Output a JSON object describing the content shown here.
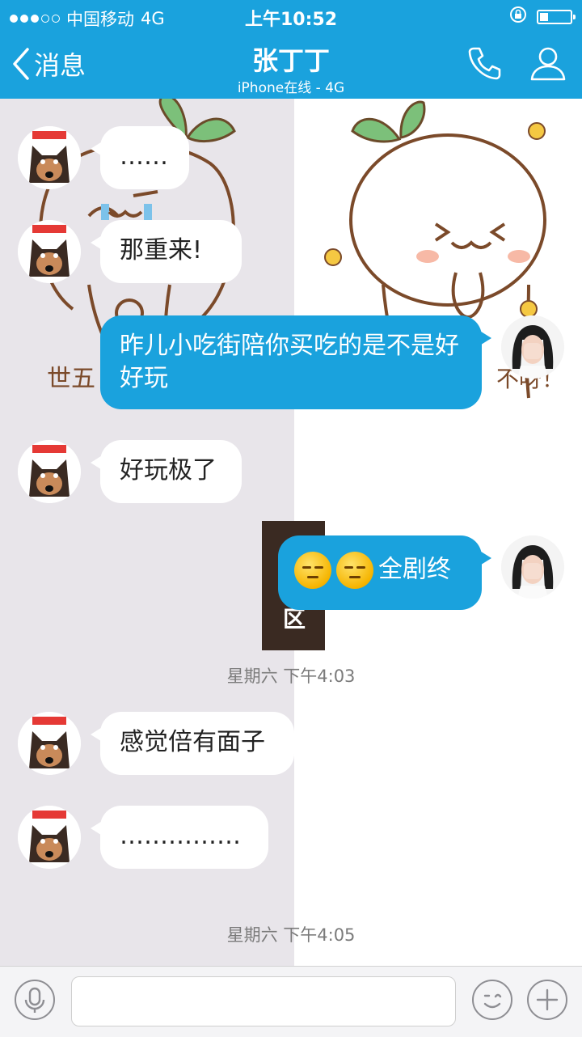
{
  "status_bar": {
    "carrier": "中国移动",
    "network": "4G",
    "time": "上午10:52"
  },
  "nav": {
    "back_label": "消息",
    "contact_name": "张丁丁",
    "contact_status": "iPhone在线 - 4G"
  },
  "messages": [
    {
      "from": "contact",
      "text": "……"
    },
    {
      "from": "contact",
      "text": "那重来!"
    },
    {
      "from": "me",
      "text": "昨儿小吃街陪你买吃的是不是好好玩"
    },
    {
      "from": "contact",
      "text": "好玩极了"
    },
    {
      "from": "me",
      "emoji": [
        "smile-icon",
        "smile-icon"
      ],
      "text": "全剧终"
    },
    {
      "from": "contact",
      "text": "感觉倍有面子"
    },
    {
      "from": "contact",
      "text": "……………"
    }
  ],
  "timestamps": [
    "星期六 下午4:03",
    "星期六 下午4:05"
  ],
  "background_text": {
    "left_bottom": "世五",
    "right_bottom": "不呀！",
    "card": "区"
  },
  "input": {
    "value": "",
    "placeholder": ""
  },
  "colors": {
    "accent": "#1aa2dd",
    "bubble_in": "#ffffff",
    "bubble_out": "#1aa2dd"
  }
}
